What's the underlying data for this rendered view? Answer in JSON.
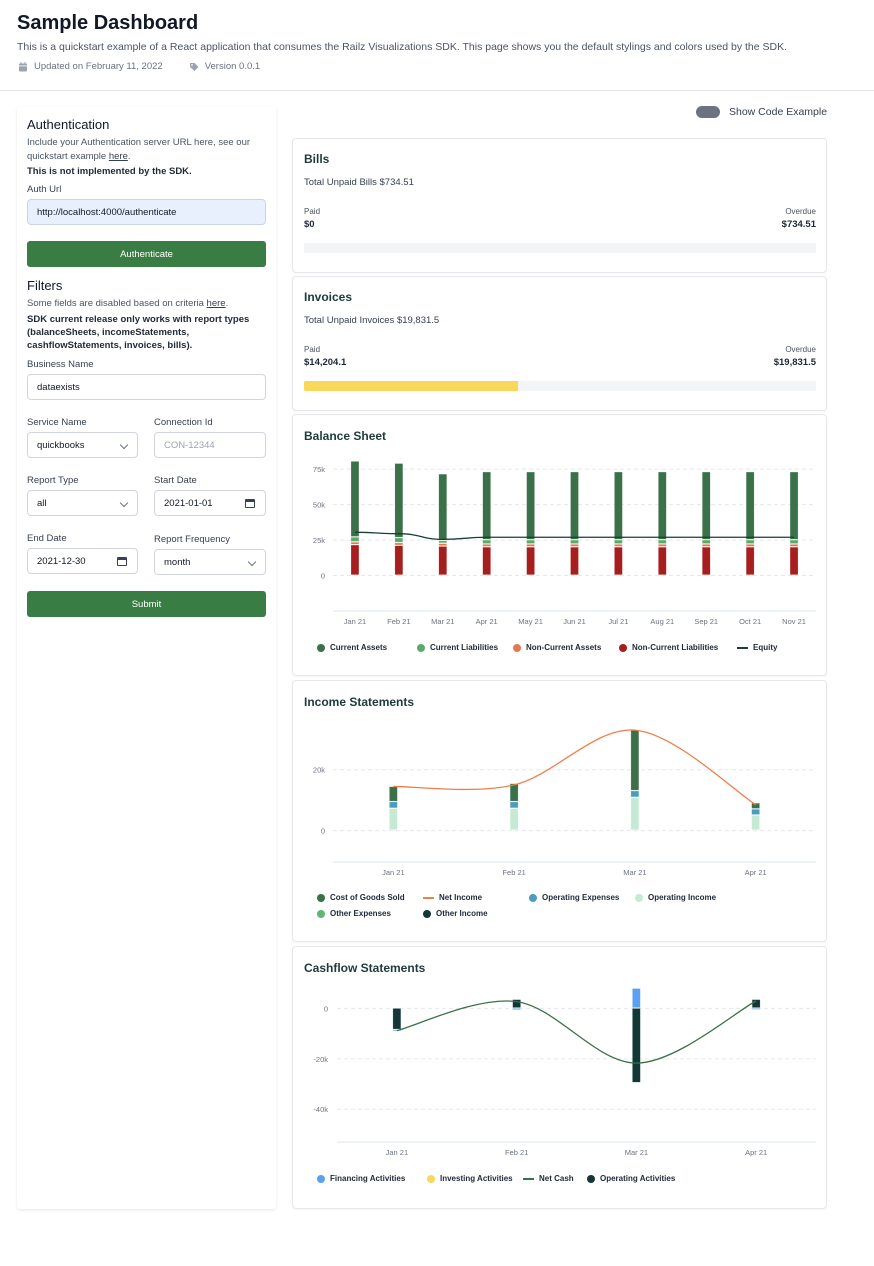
{
  "header": {
    "title": "Sample Dashboard",
    "description": "This is a quickstart example of a React application that consumes the Railz Visualizations SDK. This page shows you the default stylings and colors used by the SDK.",
    "updated": "Updated on February 11, 2022",
    "version": "Version 0.0.1",
    "icons": [
      "calendar-icon",
      "tag-icon"
    ]
  },
  "sidebar": {
    "auth": {
      "heading": "Authentication",
      "text_prefix": "Include your Authentication server URL here, see our quickstart example ",
      "link": "here",
      "text_suffix": ".",
      "warning": "This is not implemented by the SDK.",
      "auth_url_label": "Auth Url",
      "auth_url_value": "http://localhost:4000/authenticate",
      "button": "Authenticate"
    },
    "filters": {
      "heading": "Filters",
      "text_prefix": "Some fields are disabled based on criteria ",
      "link": "here",
      "text_suffix": ".",
      "note": "SDK current release only works with report types (balanceSheets, incomeStatements, cashflowStatements, invoices, bills).",
      "business_name_label": "Business Name",
      "business_name_value": "dataexists",
      "service_name_label": "Service Name",
      "service_name_value": "quickbooks",
      "connection_id_label": "Connection Id",
      "connection_id_placeholder": "CON-12344",
      "report_type_label": "Report Type",
      "report_type_value": "all",
      "start_date_label": "Start Date",
      "start_date_value": "2021-01-01",
      "end_date_label": "End Date",
      "end_date_value": "2021-12-30",
      "report_frequency_label": "Report Frequency",
      "report_frequency_value": "month",
      "submit": "Submit"
    }
  },
  "toggle": {
    "label": "Show Code Example",
    "on": false
  },
  "bills": {
    "title": "Bills",
    "total": "Total Unpaid Bills $734.51",
    "paid_label": "Paid",
    "paid_value": "$0",
    "overdue_label": "Overdue",
    "overdue_value": "$734.51",
    "paid_fraction": 0
  },
  "invoices": {
    "title": "Invoices",
    "total": "Total Unpaid Invoices $19,831.5",
    "paid_label": "Paid",
    "paid_value": "$14,204.1",
    "overdue_label": "Overdue",
    "overdue_value": "$19,831.5",
    "paid_fraction": 0.417
  },
  "chart_data": [
    {
      "type": "bar",
      "title": "Balance Sheet",
      "stacked": true,
      "categories": [
        "Jan 21",
        "Feb 21",
        "Mar 21",
        "Apr 21",
        "May 21",
        "Jun 21",
        "Jul 21",
        "Aug 21",
        "Sep 21",
        "Oct 21",
        "Nov 21"
      ],
      "yticks": [
        0,
        25000,
        50000,
        75000
      ],
      "ytick_labels": [
        "0",
        "25k",
        "50k",
        "75k"
      ],
      "ylim": [
        -25000,
        85000
      ],
      "grid": true,
      "legend_position": "bottom-left",
      "series": [
        {
          "name": "Non-Current Liabilities",
          "color": "#a61e1e",
          "kind": "bar",
          "values": [
            21500,
            21000,
            20500,
            20000,
            20000,
            20000,
            20000,
            20000,
            20000,
            20000,
            20000
          ]
        },
        {
          "name": "Non-Current Assets",
          "color": "#e8774f",
          "kind": "bar",
          "values": [
            2000,
            2000,
            2000,
            2000,
            2000,
            2000,
            2000,
            2000,
            2000,
            2000,
            2000
          ]
        },
        {
          "name": "Current Liabilities",
          "color": "#5aab6b",
          "kind": "bar",
          "values": [
            3500,
            3500,
            2000,
            3000,
            3000,
            3000,
            3000,
            3000,
            3000,
            3000,
            3000
          ]
        },
        {
          "name": "Current Assets",
          "color": "#3a7149",
          "kind": "bar",
          "values": [
            53500,
            52500,
            47000,
            48000,
            48000,
            48000,
            48000,
            48000,
            48000,
            48000,
            48000
          ]
        },
        {
          "name": "Equity",
          "color": "#1d3b3b",
          "kind": "line",
          "values": [
            30500,
            29500,
            25500,
            27000,
            27000,
            27000,
            27000,
            27000,
            27000,
            27000,
            27000
          ]
        }
      ],
      "legend": [
        "Current Assets",
        "Current Liabilities",
        "Non-Current Assets",
        "Non-Current Liabilities",
        "Equity"
      ]
    },
    {
      "type": "bar",
      "title": "Income Statements",
      "stacked": true,
      "categories": [
        "Jan 21",
        "Feb 21",
        "Mar 21",
        "Apr 21"
      ],
      "yticks": [
        0,
        20000
      ],
      "ytick_labels": [
        "0",
        "20k"
      ],
      "ylim": [
        -10000,
        36000
      ],
      "grid": true,
      "legend_position": "bottom-left",
      "series": [
        {
          "name": "Operating Income",
          "color": "#c5ead3",
          "kind": "bar",
          "values": [
            7200,
            7200,
            10800,
            5000
          ]
        },
        {
          "name": "Operating Expenses",
          "color": "#4a9dbf",
          "kind": "bar",
          "values": [
            2200,
            2200,
            2200,
            2000
          ]
        },
        {
          "name": "Cost of Goods Sold",
          "color": "#3a7149",
          "kind": "bar",
          "values": [
            5000,
            6000,
            20000,
            2000
          ]
        },
        {
          "name": "Other Expenses",
          "color": "#5fb871",
          "kind": "bar",
          "values": [
            0,
            0,
            0,
            0
          ]
        },
        {
          "name": "Other Income",
          "color": "#133636",
          "kind": "bar",
          "values": [
            0,
            0,
            0,
            0
          ]
        },
        {
          "name": "Net Income",
          "color": "#ef7f4a",
          "kind": "line",
          "values": [
            14500,
            15000,
            33000,
            8500
          ]
        }
      ],
      "legend": [
        "Cost of Goods Sold",
        "Net Income",
        "Operating Expenses",
        "Operating Income",
        "Other Expenses",
        "Other Income"
      ]
    },
    {
      "type": "bar",
      "title": "Cashflow Statements",
      "stacked": true,
      "categories": [
        "Jan 21",
        "Feb 21",
        "Mar 21",
        "Apr 21"
      ],
      "yticks": [
        -40000,
        -20000,
        0
      ],
      "ytick_labels": [
        "-40k",
        "-20k",
        "0"
      ],
      "ylim": [
        -53000,
        8500
      ],
      "grid": true,
      "legend_position": "bottom-left",
      "series": [
        {
          "name": "Operating Activities",
          "color": "#133636",
          "kind": "bar",
          "values": [
            -8500,
            3500,
            -29600,
            3500
          ]
        },
        {
          "name": "Financing Activities",
          "color": "#5aa1f2",
          "kind": "bar",
          "values": [
            -300,
            -800,
            7900,
            -500
          ]
        },
        {
          "name": "Investing Activities",
          "color": "#f9d75a",
          "kind": "bar",
          "values": [
            0,
            0,
            0,
            0
          ]
        },
        {
          "name": "Net Cash",
          "color": "#3a7149",
          "kind": "line",
          "values": [
            -8800,
            2700,
            -21700,
            3000
          ]
        }
      ],
      "legend": [
        "Financing Activities",
        "Investing Activities",
        "Net Cash",
        "Operating Activities"
      ]
    }
  ]
}
